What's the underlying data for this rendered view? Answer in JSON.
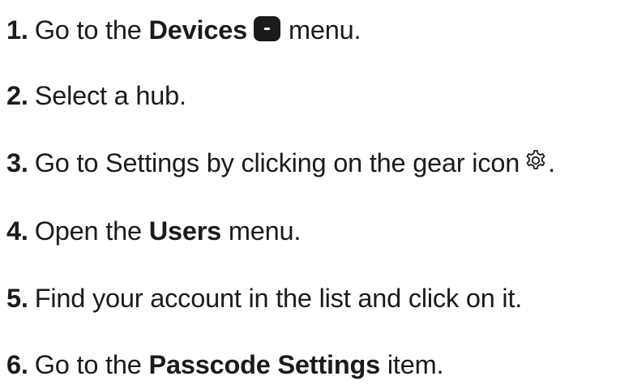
{
  "steps": [
    {
      "number": "1.",
      "text_before": "Go to the",
      "bold": "Devices",
      "text_after": "menu."
    },
    {
      "number": "2.",
      "text": "Select a hub."
    },
    {
      "number": "3.",
      "text_before": "Go to Settings by clicking on the gear icon",
      "text_after": "."
    },
    {
      "number": "4.",
      "text_before": "Open the",
      "bold": "Users",
      "text_after": "menu."
    },
    {
      "number": "5.",
      "text": "Find your account in the list and click on it."
    },
    {
      "number": "6.",
      "text_before": "Go to the",
      "bold": "Passcode Settings",
      "text_after": "item."
    }
  ],
  "icons": {
    "devices": "devices-icon",
    "settings": "gear-icon"
  },
  "colors": {
    "text": "#1b1b1b",
    "background": "#ffffff"
  }
}
